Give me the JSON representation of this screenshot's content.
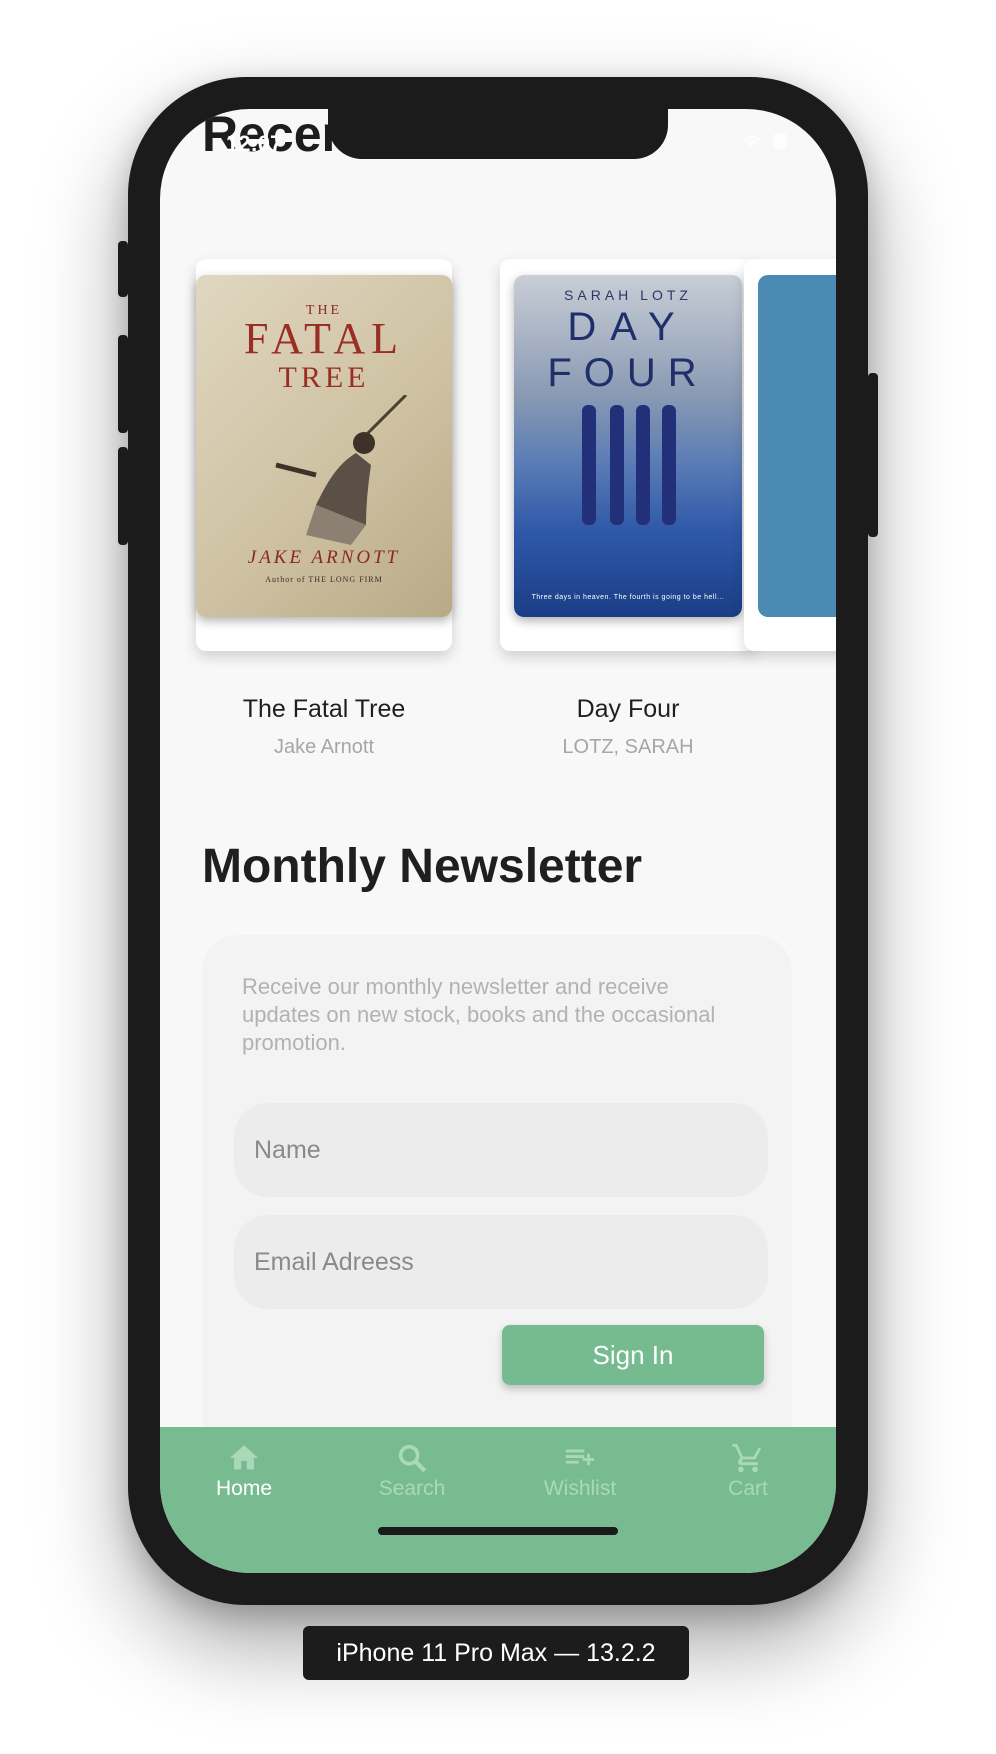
{
  "status_bar": {
    "time": "12:07"
  },
  "sections": {
    "recent_heading": "Recent",
    "newsletter_heading": "Monthly Newsletter"
  },
  "books": [
    {
      "title": "The Fatal Tree",
      "author": "Jake Arnott",
      "cover": {
        "small_word": "THE",
        "title_line1": "FATAL",
        "title_line2": "TREE",
        "author_line": "JAKE ARNOTT",
        "subline": "Author of THE LONG FIRM"
      }
    },
    {
      "title": "Day Four",
      "author": "LOTZ, SARAH",
      "cover": {
        "author_line": "SARAH LOTZ",
        "title_line1": "DAY",
        "title_line2": "FOUR",
        "tagline": "Three days in heaven. The fourth is going to be hell..."
      }
    }
  ],
  "newsletter": {
    "description": "Receive our monthly newsletter and receive updates on new stock, books and the occasional promotion.",
    "name_placeholder": "Name",
    "email_placeholder": "Email Adreess",
    "signin_label": "Sign In"
  },
  "nav": {
    "items": [
      {
        "label": "Home",
        "icon": "home-icon",
        "active": true
      },
      {
        "label": "Search",
        "icon": "search-icon",
        "active": false
      },
      {
        "label": "Wishlist",
        "icon": "playlist-add-icon",
        "active": false
      },
      {
        "label": "Cart",
        "icon": "cart-icon",
        "active": false
      }
    ]
  },
  "device_label": "iPhone 11 Pro Max — 13.2.2",
  "colors": {
    "accent": "#78bb91",
    "button": "#76bb90",
    "inactive_nav": "#a9d9b9",
    "screen_bg": "#f8f8f8",
    "frame": "#1b1b1b"
  }
}
